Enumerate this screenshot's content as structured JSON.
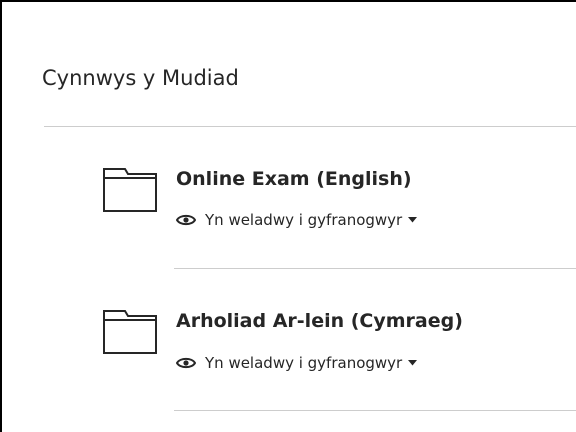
{
  "module": {
    "title": "Cynnwys y Mudiad"
  },
  "items": [
    {
      "title": "Online Exam (English)",
      "visibility": "Yn weladwy i gyfranogwyr"
    },
    {
      "title": "Arholiad Ar-lein (Cymraeg)",
      "visibility": "Yn weladwy i gyfranogwyr"
    }
  ],
  "icons": {
    "item": "folder-icon",
    "visibility": "eye-icon",
    "dropdown": "caret-down-icon"
  }
}
